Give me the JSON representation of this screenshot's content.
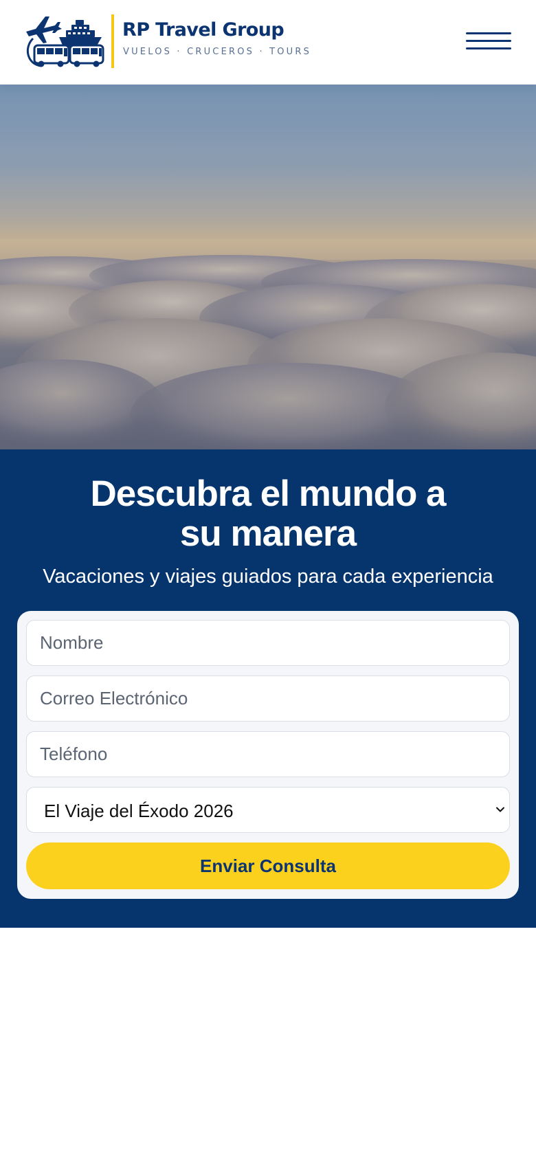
{
  "header": {
    "logo_icon": "plane-ship-bus-logo-icon",
    "brand_name": "RP Travel Group",
    "tagline": "VUELOS · CRUCEROS · TOURS",
    "menu_icon": "hamburger-menu-icon"
  },
  "hero": {
    "image": "sky-above-clouds-sunset"
  },
  "lead": {
    "headline_line1": "Descubra el mundo a",
    "headline_line2": "su manera",
    "subheadline": "Vacaciones y viajes guiados para cada experiencia",
    "form": {
      "name_placeholder": "Nombre",
      "email_placeholder": "Correo Electrónico",
      "phone_placeholder": "Teléfono",
      "trip_selected": "El Viaje del Éxodo 2026",
      "submit_label": "Enviar Consulta"
    }
  },
  "colors": {
    "brand_navy": "#0b3470",
    "section_navy": "#06356d",
    "accent_yellow": "#fcd11d",
    "divider_yellow": "#f5c518"
  }
}
